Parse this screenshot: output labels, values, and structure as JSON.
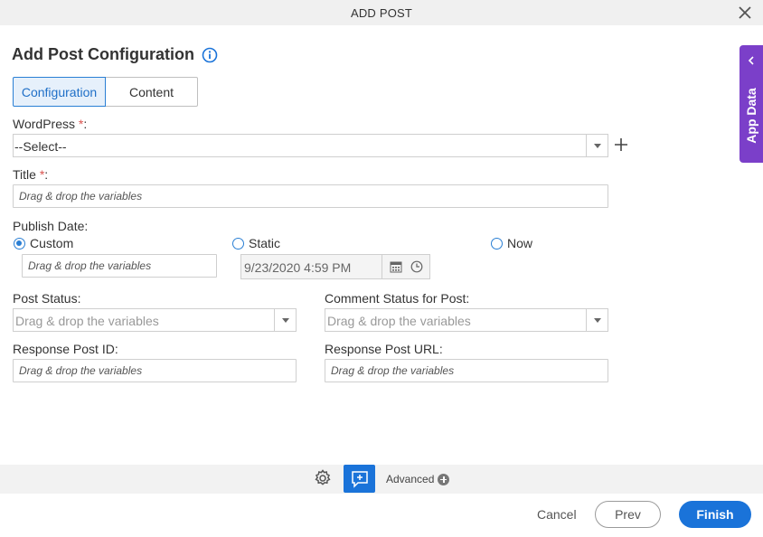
{
  "window": {
    "title": "ADD POST"
  },
  "heading": "Add Post Configuration",
  "tabs": [
    {
      "label": "Configuration"
    },
    {
      "label": "Content"
    }
  ],
  "wordpress": {
    "label": "WordPress",
    "required": "*",
    "colon": ":",
    "value": "--Select--"
  },
  "title_field": {
    "label": "Title",
    "required": "*",
    "colon": ":",
    "placeholder": "Drag & drop the variables"
  },
  "publish_date": {
    "label": "Publish Date:",
    "options": {
      "custom": "Custom",
      "static": "Static",
      "now": "Now"
    },
    "selected": "custom",
    "custom_placeholder": "Drag & drop the variables",
    "static_value": "9/23/2020 4:59 PM"
  },
  "post_status": {
    "label": "Post Status:",
    "placeholder": "Drag & drop the variables"
  },
  "comment_status": {
    "label": "Comment Status for Post:",
    "placeholder": "Drag & drop the variables"
  },
  "response_post_id": {
    "label": "Response Post ID:",
    "placeholder": "Drag & drop the variables"
  },
  "response_post_url": {
    "label": "Response Post URL:",
    "placeholder": "Drag & drop the variables"
  },
  "bottom": {
    "advanced": "Advanced"
  },
  "buttons": {
    "cancel": "Cancel",
    "prev": "Prev",
    "finish": "Finish"
  },
  "side_panel": {
    "label": "App Data"
  },
  "colors": {
    "accent": "#1a73d9",
    "side_panel": "#7b3fc9",
    "required": "#d9534f"
  },
  "icons": [
    "close-icon",
    "info-icon",
    "plus-icon",
    "calendar-icon",
    "clock-icon",
    "gear-icon",
    "add-note-icon",
    "plus-circle-icon",
    "chevron-left-icon"
  ]
}
